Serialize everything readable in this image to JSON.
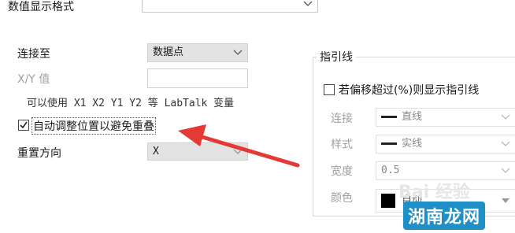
{
  "top": {
    "display_format_label": "数值显示格式",
    "display_format_value": ""
  },
  "connect": {
    "connect_to_label": "连接至",
    "connect_to_value": "数据点",
    "xy_value_label": "X/Y 值",
    "xy_value_input": "",
    "hint": "可以使用 X1 X2 Y1 Y2 等 LabTalk 变量",
    "auto_adjust_label": "自动调整位置以避免重叠",
    "auto_adjust_checked": true,
    "reset_direction_label": "重置方向",
    "reset_direction_value": "X"
  },
  "leader": {
    "title": "指引线",
    "offset_check_label": "若偏移超过(%)则显示指引线",
    "offset_checked": false,
    "connect_label": "连接",
    "connect_value": "直线",
    "style_label": "样式",
    "style_value": "实线",
    "width_label": "宽度",
    "width_value": "0.5",
    "color_label": "颜色",
    "color_value": "自动",
    "color_swatch": "#000000"
  },
  "colors": {
    "arrow": "#e53935"
  },
  "watermark": {
    "text": "Bai 经验",
    "site": "湖南龙网"
  }
}
